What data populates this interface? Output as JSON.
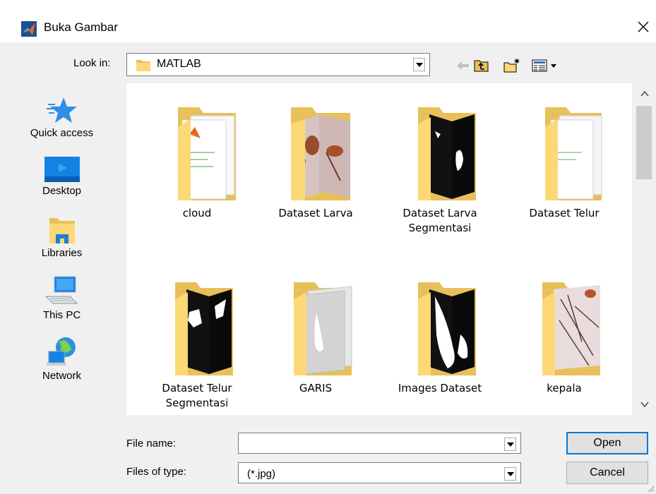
{
  "window": {
    "title": "Buka Gambar"
  },
  "lookin": {
    "label": "Look in:",
    "value": "MATLAB"
  },
  "places": [
    {
      "label": "Quick access",
      "icon": "star-icon"
    },
    {
      "label": "Desktop",
      "icon": "desktop-icon"
    },
    {
      "label": "Libraries",
      "icon": "libraries-icon"
    },
    {
      "label": "This PC",
      "icon": "computer-icon"
    },
    {
      "label": "Network",
      "icon": "network-icon"
    }
  ],
  "folders": [
    {
      "label": "cloud",
      "preview": "matlab-doc"
    },
    {
      "label": "Dataset Larva",
      "preview": "larva-photo"
    },
    {
      "label": "Dataset Larva Segmentasi",
      "preview": "segment-black"
    },
    {
      "label": "Dataset Telur",
      "preview": "matlab-doc"
    },
    {
      "label": "Dataset Telur Segmentasi",
      "preview": "segment-black"
    },
    {
      "label": "GARIS",
      "preview": "gray-doc"
    },
    {
      "label": "Images Dataset",
      "preview": "segment-black"
    },
    {
      "label": "kepala",
      "preview": "larva-photo"
    }
  ],
  "filename": {
    "label": "File name:",
    "value": ""
  },
  "filetype": {
    "label": "Files of type:",
    "value": "(*.jpg)"
  },
  "buttons": {
    "open": "Open",
    "cancel": "Cancel"
  },
  "colors": {
    "folder_back": "#e8c05a",
    "folder_front": "#fcd877",
    "accent": "#0078d7"
  }
}
